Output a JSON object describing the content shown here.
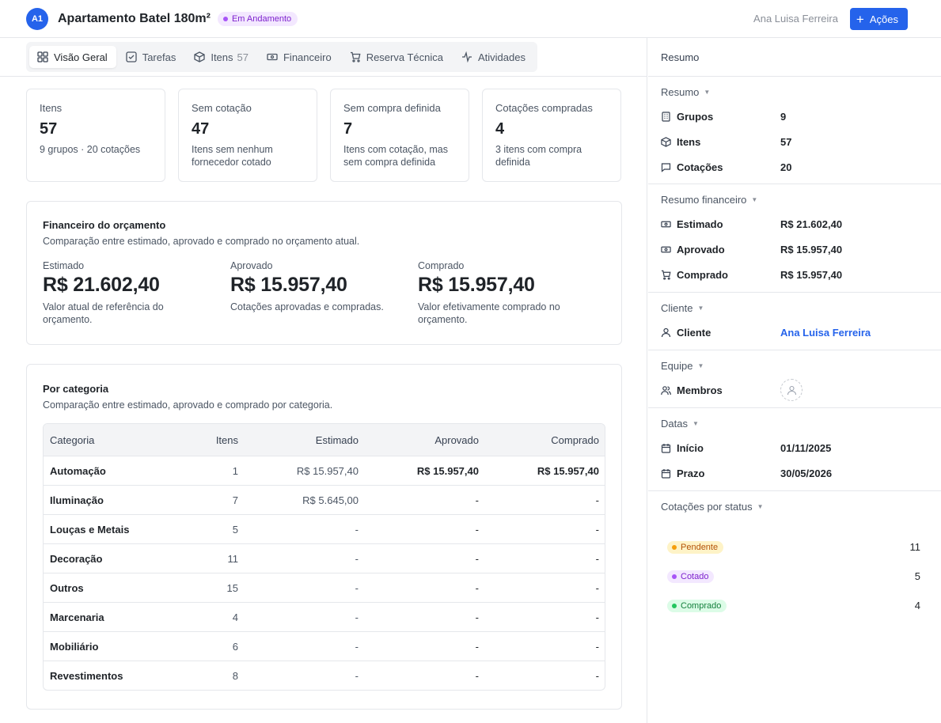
{
  "header": {
    "avatar": "A1",
    "title": "Apartamento Batel 180m²",
    "status": "Em Andamento",
    "user": "Ana Luisa Ferreira",
    "actions_label": "Ações",
    "accent_color": "#2563eb"
  },
  "tabs": [
    {
      "label": "Visão Geral",
      "icon": "grid-icon",
      "active": true
    },
    {
      "label": "Tarefas",
      "icon": "checkbox-icon"
    },
    {
      "label": "Itens",
      "icon": "box-icon",
      "count": "57"
    },
    {
      "label": "Financeiro",
      "icon": "banknote-icon"
    },
    {
      "label": "Reserva Técnica",
      "icon": "cart-icon"
    },
    {
      "label": "Atividades",
      "icon": "activity-icon"
    }
  ],
  "cards": [
    {
      "label": "Itens",
      "value": "57",
      "sub": "9 grupos · 20 cotações"
    },
    {
      "label": "Sem cotação",
      "value": "47",
      "sub": "Itens sem nenhum fornecedor cotado"
    },
    {
      "label": "Sem compra definida",
      "value": "7",
      "sub": "Itens com cotação, mas sem compra definida"
    },
    {
      "label": "Cotações compradas",
      "value": "4",
      "sub": "3 itens com compra definida"
    }
  ],
  "financeiro": {
    "title": "Financeiro do orçamento",
    "subtitle": "Comparação entre estimado, aprovado e comprado no orçamento atual.",
    "cols": [
      {
        "label": "Estimado",
        "value": "R$ 21.602,40",
        "note": "Valor atual de referência do orçamento."
      },
      {
        "label": "Aprovado",
        "value": "R$ 15.957,40",
        "note": "Cotações aprovadas e compradas."
      },
      {
        "label": "Comprado",
        "value": "R$ 15.957,40",
        "note": "Valor efetivamente comprado no orçamento."
      }
    ]
  },
  "categoria": {
    "title": "Por categoria",
    "subtitle": "Comparação entre estimado, aprovado e comprado por categoria.",
    "headers": [
      "Categoria",
      "Itens",
      "Estimado",
      "Aprovado",
      "Comprado"
    ],
    "rows": [
      [
        "Automação",
        "1",
        "R$ 15.957,40",
        "R$ 15.957,40",
        "R$ 15.957,40"
      ],
      [
        "Iluminação",
        "7",
        "R$ 5.645,00",
        "-",
        "-"
      ],
      [
        "Louças e Metais",
        "5",
        "-",
        "-",
        "-"
      ],
      [
        "Decoração",
        "11",
        "-",
        "-",
        "-"
      ],
      [
        "Outros",
        "15",
        "-",
        "-",
        "-"
      ],
      [
        "Marcenaria",
        "4",
        "-",
        "-",
        "-"
      ],
      [
        "Mobiliário",
        "6",
        "-",
        "-",
        "-"
      ],
      [
        "Revestimentos",
        "8",
        "-",
        "-",
        "-"
      ]
    ]
  },
  "sidebar": {
    "head": "Resumo",
    "resumo": {
      "title": "Resumo",
      "rows": [
        {
          "label": "Grupos",
          "value": "9",
          "icon": "building-icon"
        },
        {
          "label": "Itens",
          "value": "57",
          "icon": "box-icon"
        },
        {
          "label": "Cotações",
          "value": "20",
          "icon": "message-icon"
        }
      ]
    },
    "financeiro": {
      "title": "Resumo financeiro",
      "rows": [
        {
          "label": "Estimado",
          "value": "R$ 21.602,40",
          "icon": "banknote-icon"
        },
        {
          "label": "Aprovado",
          "value": "R$ 15.957,40",
          "icon": "banknote-icon"
        },
        {
          "label": "Comprado",
          "value": "R$ 15.957,40",
          "icon": "cart-icon"
        }
      ]
    },
    "cliente": {
      "title": "Cliente",
      "label": "Cliente",
      "value": "Ana Luisa Ferreira"
    },
    "equipe": {
      "title": "Equipe",
      "label": "Membros"
    },
    "datas": {
      "title": "Datas",
      "rows": [
        {
          "label": "Início",
          "value": "01/11/2025"
        },
        {
          "label": "Prazo",
          "value": "30/05/2026"
        }
      ]
    },
    "status": {
      "title": "Cotações por status",
      "rows": [
        {
          "label": "Pendente",
          "value": "11",
          "color": "#d97706",
          "bg": "#fef3c7"
        },
        {
          "label": "Cotado",
          "value": "5",
          "color": "#7e22ce",
          "bg": "#f3e8ff"
        },
        {
          "label": "Comprado",
          "value": "4",
          "color": "#15803d",
          "bg": "#dcfce7"
        }
      ]
    }
  }
}
